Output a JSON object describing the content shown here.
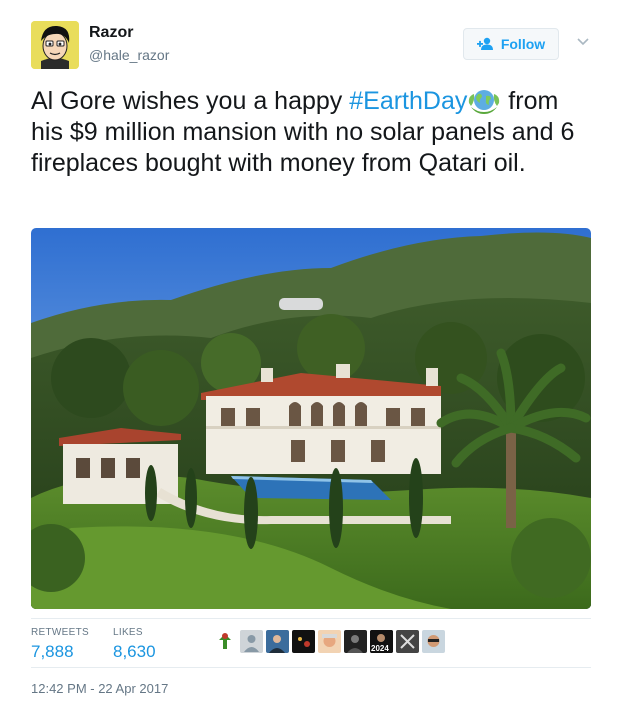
{
  "user": {
    "name": "Razor",
    "handle": "@hale_razor",
    "avatar_icon": "cartoon-man-avatar-icon"
  },
  "follow": {
    "label": "Follow",
    "icon": "add-user-icon",
    "color": "#1da1f2"
  },
  "menu": {
    "icon": "chevron-down-icon"
  },
  "tweet": {
    "text_before": "Al Gore wishes you a happy ",
    "hashtag": "#EarthDay",
    "emoji": "earth-emoji-icon",
    "text_after": " from his $9 million mansion with no solar panels and 6 fireplaces bought with money from Qatari oil.",
    "hashtag_color": "#1b95e0"
  },
  "media": {
    "icon": "mansion-photo"
  },
  "stats": {
    "retweets_label": "RETWEETS",
    "retweets_value": "7,888",
    "likes_label": "LIKES",
    "likes_value": "8,630"
  },
  "likers": {
    "count_shown": 9,
    "badge_text": "2024"
  },
  "timestamp": "12:42 PM - 22 Apr 2017"
}
